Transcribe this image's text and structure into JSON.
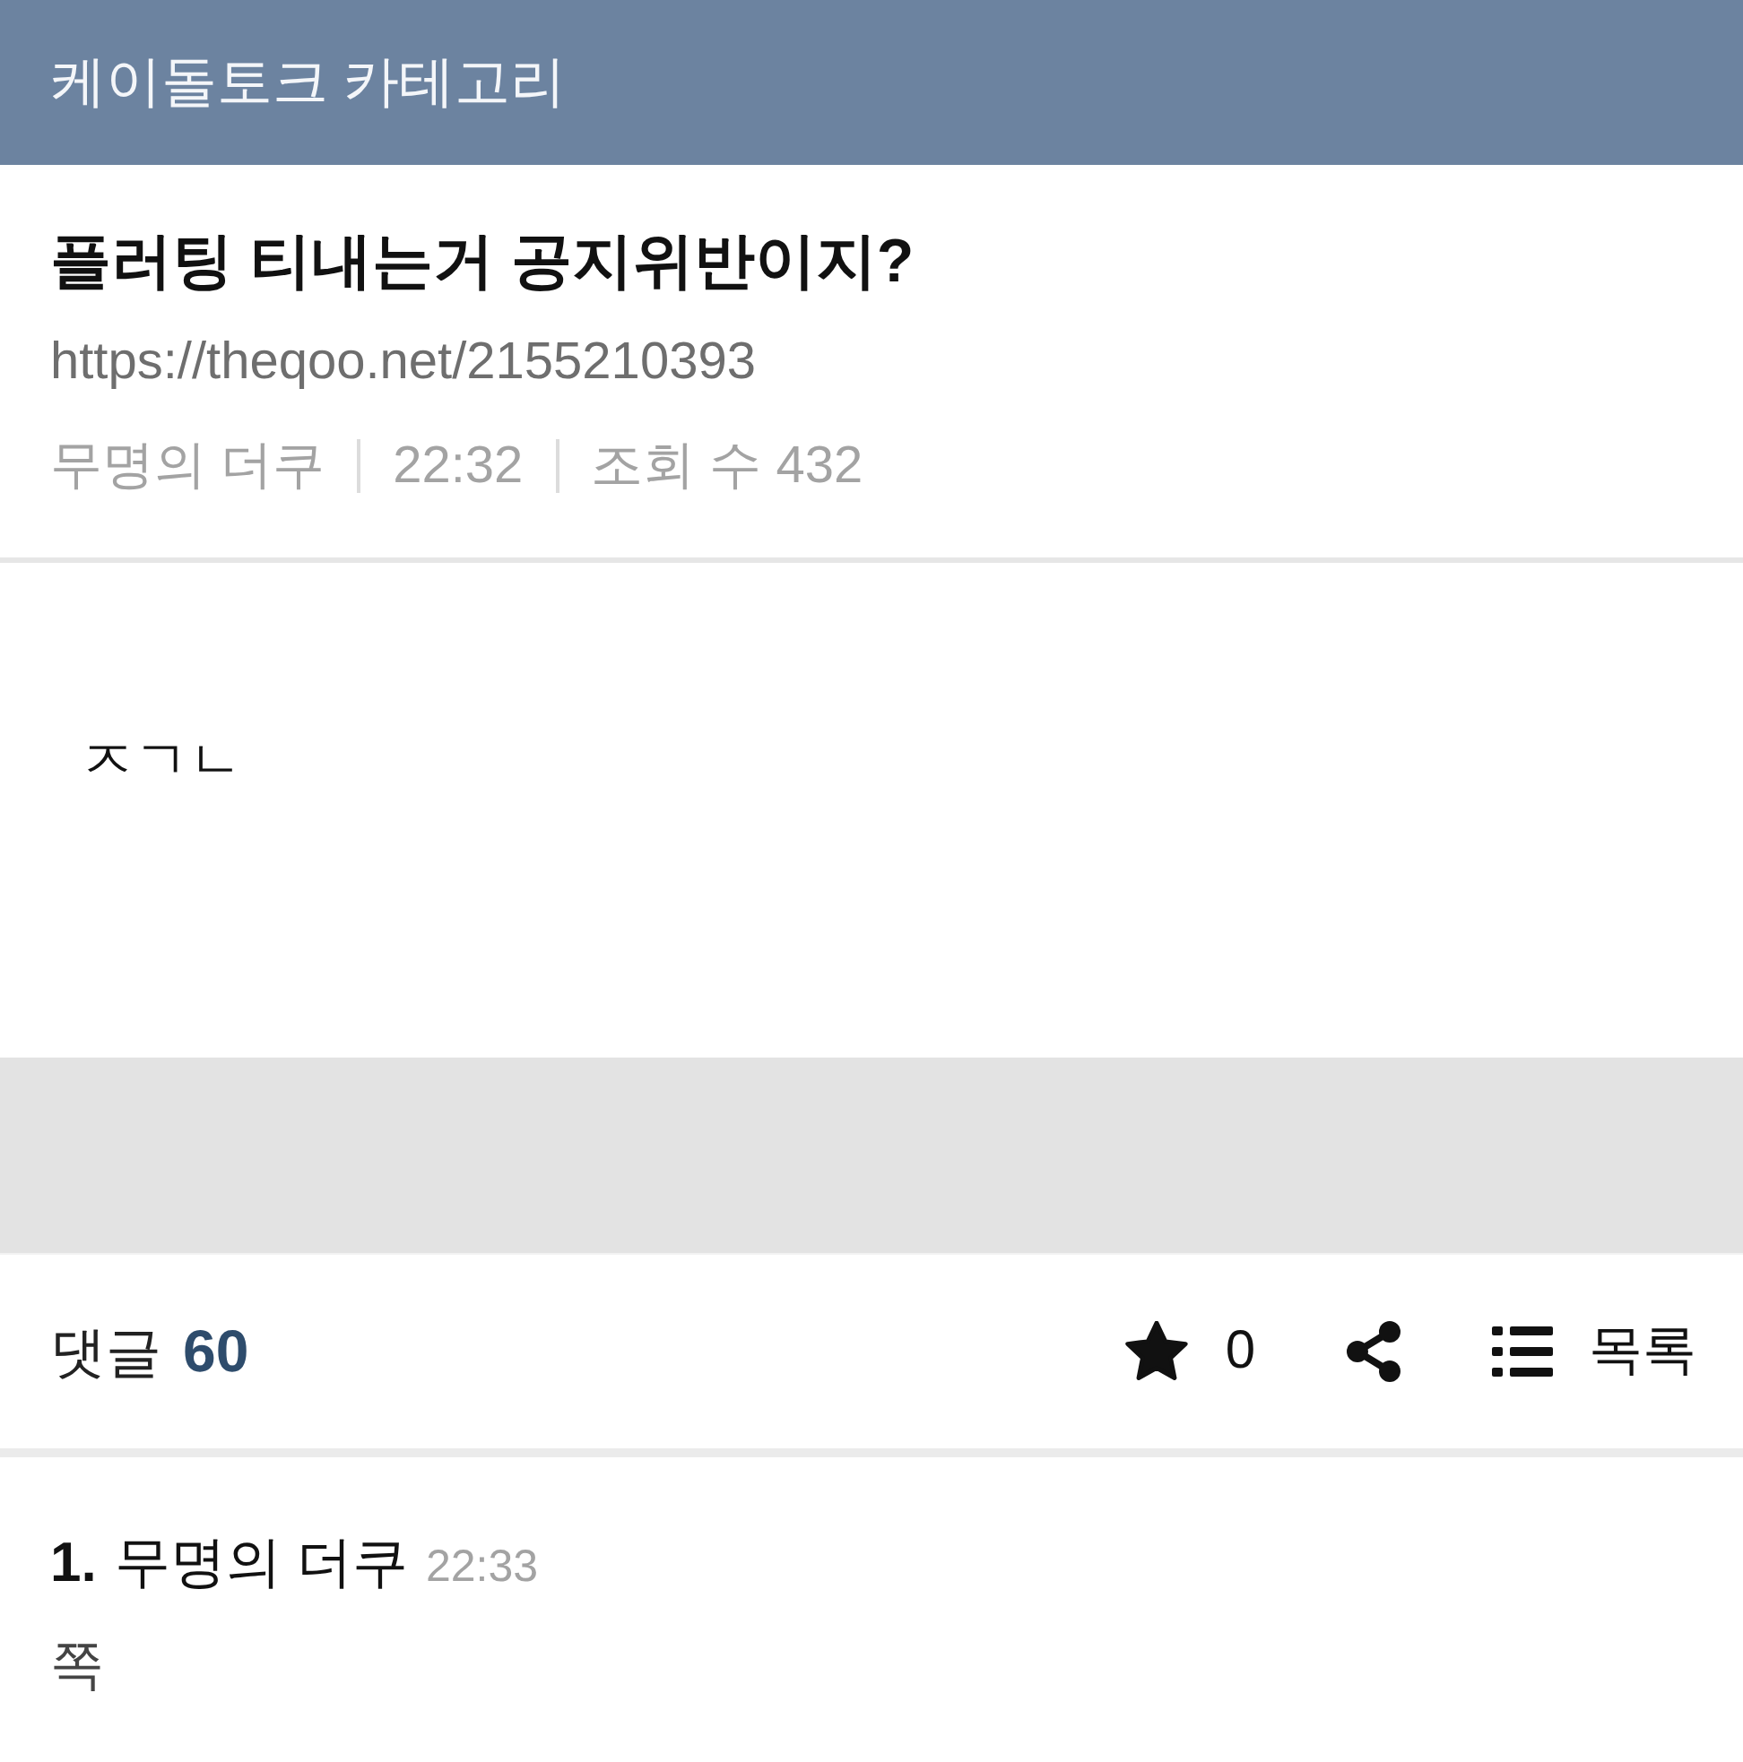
{
  "header": {
    "title": "케이돌토크 카테고리"
  },
  "post": {
    "title": "플러팅 티내는거 공지위반이지?",
    "url": "https://theqoo.net/2155210393",
    "author": "무명의 더쿠",
    "time": "22:32",
    "views": "조회 수 432",
    "body": "ㅈㄱㄴ"
  },
  "comment_bar": {
    "label": "댓글",
    "count": "60",
    "actions": [
      {
        "kind": "star",
        "label": "0"
      },
      {
        "kind": "share"
      },
      {
        "kind": "list",
        "label": "목록"
      }
    ]
  },
  "comments": [
    {
      "number": "1.",
      "author": "무명의 더쿠",
      "time": "22:33",
      "text": "쪽"
    }
  ]
}
